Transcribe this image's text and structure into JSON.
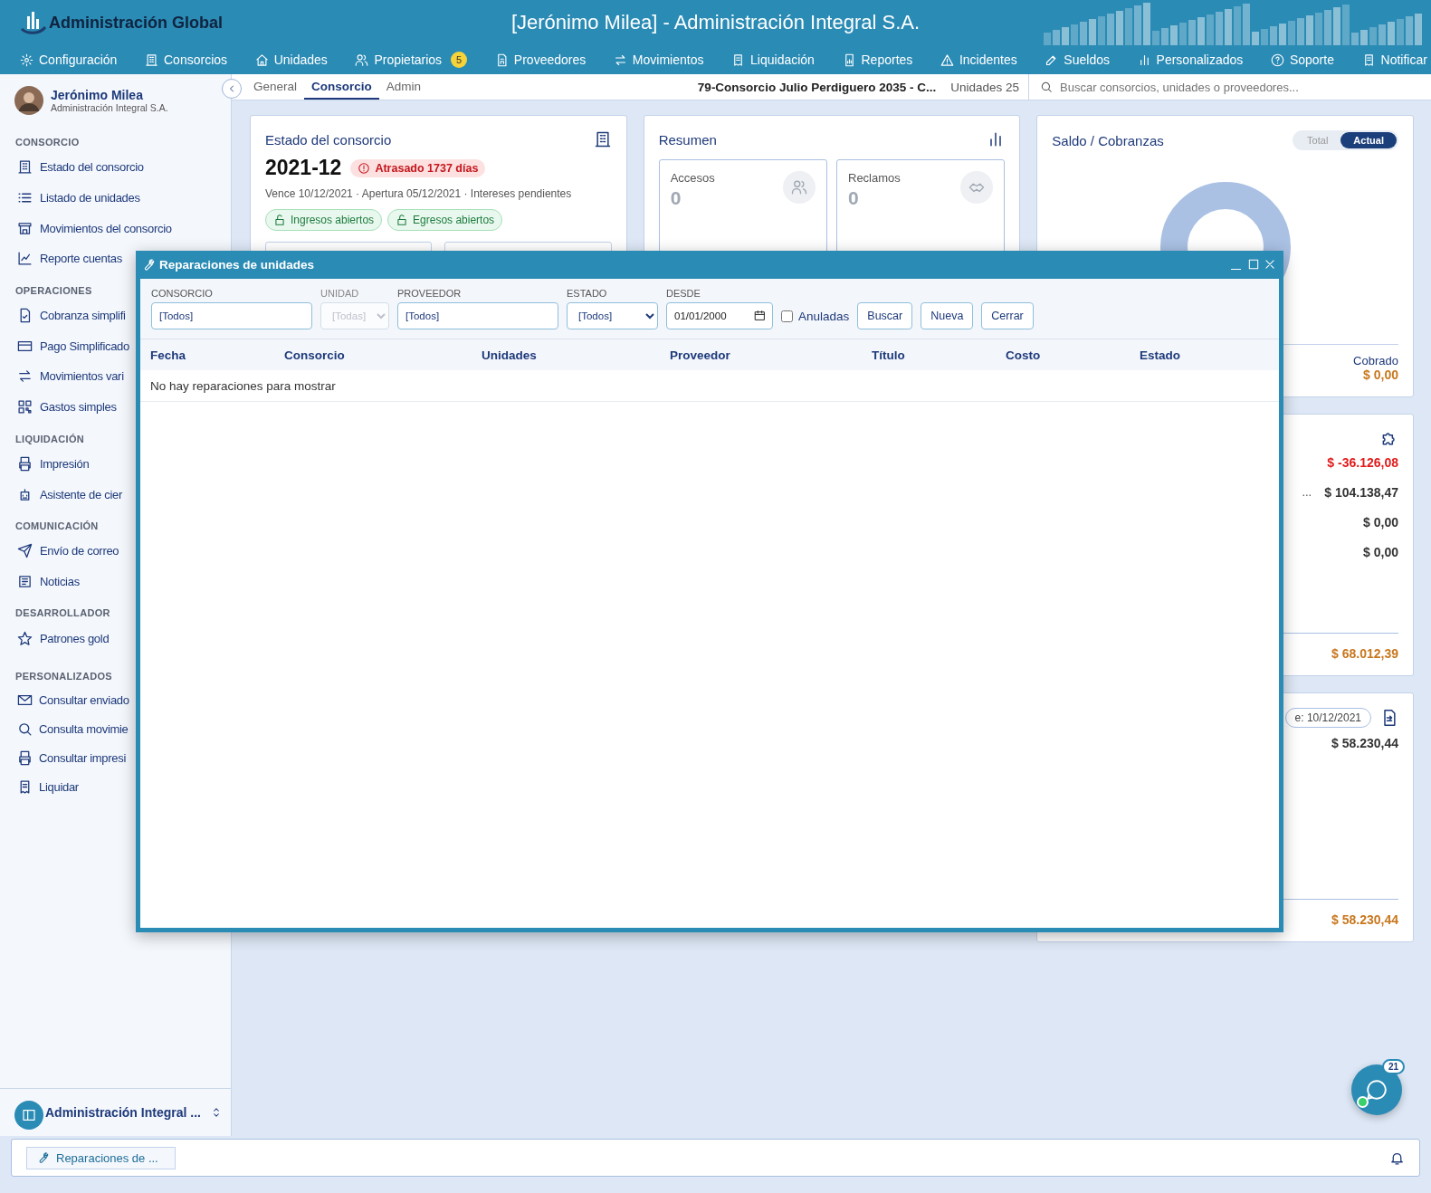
{
  "header": {
    "logo_text": "Administración Global",
    "title": "[Jerónimo Milea] - Administración Integral S.A.",
    "nav": [
      {
        "label": "Configuración"
      },
      {
        "label": "Consorcios"
      },
      {
        "label": "Unidades"
      },
      {
        "label": "Propietarios",
        "badge": "5"
      },
      {
        "label": "Proveedores"
      },
      {
        "label": "Movimientos"
      },
      {
        "label": "Liquidación"
      },
      {
        "label": "Reportes"
      },
      {
        "label": "Incidentes"
      },
      {
        "label": "Sueldos"
      },
      {
        "label": "Personalizados"
      },
      {
        "label": "Soporte"
      },
      {
        "label": "Notificar"
      }
    ]
  },
  "user": {
    "name": "Jerónimo Milea",
    "company": "Administración Integral S.A."
  },
  "sidebar": {
    "sections": [
      {
        "title": "CONSORCIO",
        "items": [
          "Estado del consorcio",
          "Listado de unidades",
          "Movimientos del consorcio",
          "Reporte cuentas"
        ]
      },
      {
        "title": "OPERACIONES",
        "items": [
          "Cobranza simplifi",
          "Pago Simplificado",
          "Movimientos vari",
          "Gastos simples"
        ]
      },
      {
        "title": "LIQUIDACIÓN",
        "items": [
          "Impresión",
          "Asistente de cier"
        ]
      },
      {
        "title": "COMUNICACIÓN",
        "items": [
          "Envío de correo",
          "Noticias"
        ]
      },
      {
        "title": "DESARROLLADOR",
        "items": [
          "Patrones gold"
        ]
      },
      {
        "title": "PERSONALIZADOS",
        "items": [
          "Consultar enviado",
          "Consulta movimie",
          "Consultar impresi",
          "Liquidar"
        ]
      }
    ],
    "footer": "Administración Integral ..."
  },
  "subheader": {
    "tabs": [
      {
        "label": "General",
        "selected": false
      },
      {
        "label": "Consorcio",
        "selected": true
      },
      {
        "label": "Admin",
        "selected": false
      }
    ],
    "consorcio": "79-Consorcio Julio Perdiguero 2035 - C...",
    "unidades": "Unidades 25",
    "search_placeholder": "Buscar consorcios, unidades o proveedores..."
  },
  "estado_card": {
    "title": "Estado del consorcio",
    "period": "2021-12",
    "status_badge": "Atrasado 1737 días",
    "details": "Vence 10/12/2021 · Apertura 05/12/2021 · Intereses pendientes",
    "chips": [
      "Ingresos abiertos",
      "Egresos abiertos"
    ]
  },
  "resumen_card": {
    "title": "Resumen",
    "stats": [
      {
        "label": "Accesos",
        "value": "0"
      },
      {
        "label": "Reclamos",
        "value": "0"
      }
    ]
  },
  "saldo_card": {
    "title": "Saldo / Cobranzas",
    "toggle": [
      {
        "label": "Total",
        "selected": false
      },
      {
        "label": "Actual",
        "selected": true
      }
    ],
    "cobrado_label": "Cobrado",
    "cobrado_value": "$ 0,00"
  },
  "balance_card": {
    "rows": [
      {
        "value": "$ -36.126,08",
        "negative": true
      },
      {
        "label": "...",
        "value": "$ 104.138,47",
        "negative": false
      },
      {
        "value": "$ 0,00",
        "negative": false
      },
      {
        "value": "$ 0,00",
        "negative": false
      }
    ],
    "total": "$ 68.012,39"
  },
  "expensas_card": {
    "due_pill": "e: 10/12/2021",
    "amount": "$ 58.230,44",
    "total": "$ 58.230,44"
  },
  "dialog": {
    "title": "Reparaciones de unidades",
    "filters": [
      {
        "kind": "text",
        "label": "CONSORCIO",
        "value": "[Todos]",
        "disabled": false
      },
      {
        "kind": "select",
        "label": "UNIDAD",
        "value": "[Todas]",
        "disabled": true
      },
      {
        "kind": "text",
        "label": "PROVEEDOR",
        "value": "[Todos]",
        "disabled": false
      },
      {
        "kind": "select",
        "label": "ESTADO",
        "value": "[Todos]",
        "disabled": false
      },
      {
        "kind": "date",
        "label": "DESDE",
        "value": "01/01/2000",
        "disabled": false
      }
    ],
    "anuladas": {
      "label": "Anuladas",
      "checked": false
    },
    "buttons": [
      "Buscar",
      "Nueva",
      "Cerrar"
    ],
    "columns": [
      "Fecha",
      "Consorcio",
      "Unidades",
      "Proveedor",
      "Título",
      "Costo",
      "Estado"
    ],
    "empty_message": "No hay reparaciones para mostrar"
  },
  "taskbar": {
    "items": [
      "Reparaciones de ..."
    ]
  },
  "chat": {
    "badge": "21",
    "online": true
  }
}
